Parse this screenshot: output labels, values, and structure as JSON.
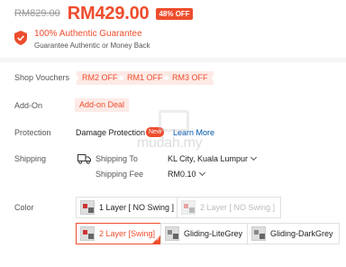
{
  "price": {
    "original": "RM829.00",
    "current": "RM429.00",
    "discount": "48% OFF"
  },
  "guarantee": {
    "title": "100% Authentic Guarantee",
    "subtitle": "Guarantee Authentic or Money Back",
    "icon": "shield-check-icon"
  },
  "vouchers": {
    "label": "Shop Vouchers",
    "items": [
      "RM2 OFF",
      "RM1 OFF",
      "RM3 OFF"
    ]
  },
  "addon": {
    "label": "Add-On",
    "deal": "Add-on Deal"
  },
  "protection": {
    "label": "Protection",
    "text": "Damage Protection",
    "badge": "New",
    "link": "Learn More"
  },
  "shipping": {
    "label": "Shipping",
    "to_label": "Shipping To",
    "to_value": "KL City, Kuala Lumpur",
    "fee_label": "Shipping Fee",
    "fee_value": "RM0.10",
    "icon": "truck-icon"
  },
  "color": {
    "label": "Color",
    "options": [
      {
        "label": "1 Layer [ NO Swing ]",
        "state": "available"
      },
      {
        "label": "2 Layer [ NO Swing ]",
        "state": "disabled"
      },
      {
        "label": "2 Layer [Swing]",
        "state": "selected"
      },
      {
        "label": "Gliding-LiteGrey",
        "state": "available"
      },
      {
        "label": "Gliding-DarkGrey",
        "state": "available"
      }
    ]
  },
  "watermark": "mudah.my",
  "colors": {
    "accent": "#ee4d2d",
    "link": "#0055aa",
    "voucher_bg": "#fdeae6"
  }
}
